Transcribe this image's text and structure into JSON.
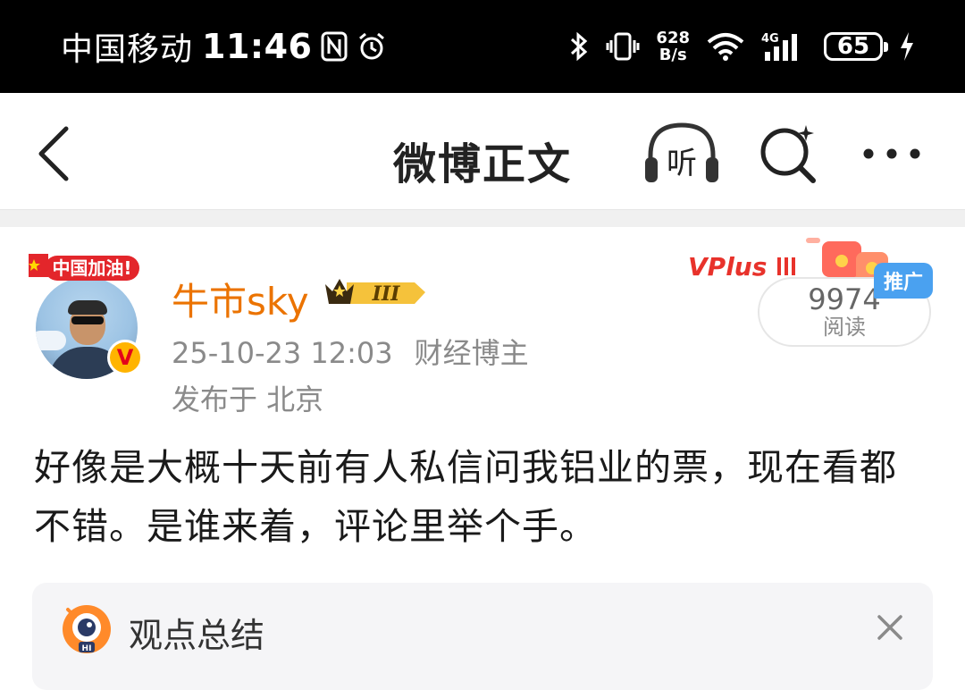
{
  "status_bar": {
    "carrier": "中国移动",
    "time": "11:46",
    "net_speed_value": "628",
    "net_speed_unit": "B/s",
    "network_type": "4G",
    "battery": "65"
  },
  "nav": {
    "title": "微博正文",
    "listen_label": "听"
  },
  "post": {
    "avatar_frame_text": "中国加油!",
    "username": "牛市sky",
    "level_badge": "III",
    "date": "25-10-23 12:03",
    "verification": "财经博主",
    "location": "发布于 北京",
    "promo_brand": "VPlus",
    "read_count": "9974",
    "read_label": "阅读",
    "promo_tag": "推广",
    "content": "好像是大概十天前有人私信问我铝业的票，现在看都不错。是谁来着，评论里举个手。"
  },
  "summary": {
    "robot_badge": "HI",
    "title": "观点总结"
  },
  "colors": {
    "username": "#eb7300",
    "meta_text": "#8a8a8a",
    "promo_tag": "#4aa1f0",
    "verified_badge": "#ffb400"
  }
}
